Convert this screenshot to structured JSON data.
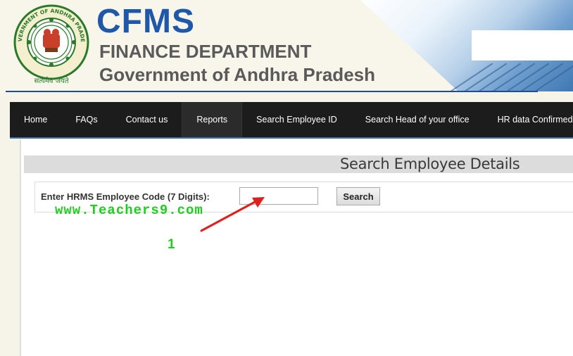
{
  "header": {
    "title": "CFMS",
    "department": "FINANCE DEPARTMENT",
    "government": "Government of Andhra Pradesh",
    "emblem": {
      "icon": "andhra-pradesh-emblem-icon",
      "ring_text": "GOVERNMENT OF ANDHRA PRADESH",
      "motto": "सत्यमेव जयते"
    }
  },
  "nav": {
    "items": [
      {
        "label": "Home"
      },
      {
        "label": "FAQs"
      },
      {
        "label": "Contact us"
      },
      {
        "label": "Reports",
        "active": true
      },
      {
        "label": "Search Employee ID"
      },
      {
        "label": "Search Head of your office"
      },
      {
        "label": "HR data Confirmed Dep"
      }
    ]
  },
  "section": {
    "title": "Search Employee Details"
  },
  "search": {
    "label": "Enter HRMS Employee Code (7 Digits):",
    "input_value": "",
    "button_label": "Search"
  },
  "overlay": {
    "watermark": "www.Teachers9.com",
    "step_number": "1",
    "color": "#1fcf1f",
    "arrow_color": "#e0201c"
  },
  "colors": {
    "title_blue": "#1f58a8",
    "nav_bg": "#1c1c1c",
    "rule_blue": "#1f4aa0"
  }
}
